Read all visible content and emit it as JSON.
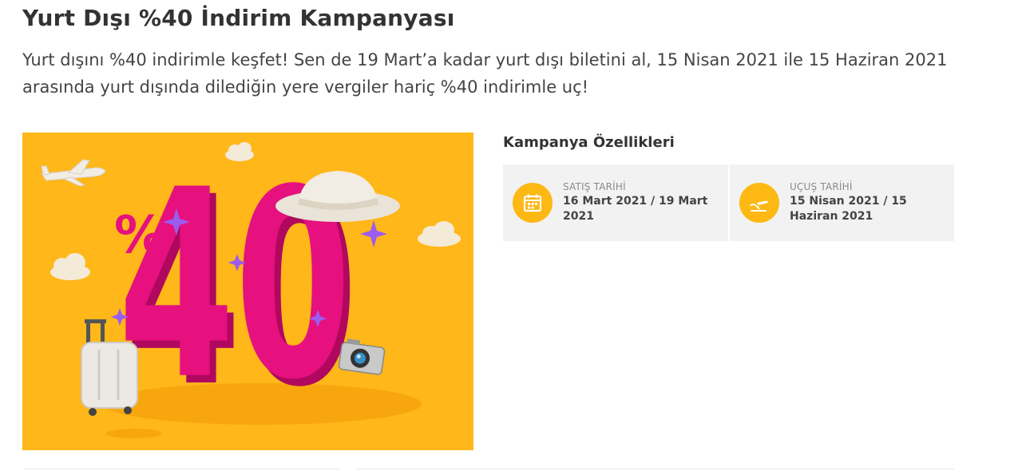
{
  "campaign": {
    "title": "Yurt Dışı %40 İndirim Kampanyası",
    "description": "Yurt dışını %40 indirimle keşfet! Sen de 19 Mart’a kadar yurt dışı biletini al, 15 Nisan 2021 ile 15 Haziran 2021 arasında yurt dışında dilediğin yere vergiler hariç %40 indirimle uç!"
  },
  "banner": {
    "percent_sign": "%",
    "number": "40"
  },
  "features": {
    "title": "Kampanya Özellikleri",
    "sales": {
      "icon": "calendar-icon",
      "label": "SATIŞ TARİHİ",
      "value": "16 Mart 2021 / 19 Mart 2021"
    },
    "flight": {
      "icon": "airplane-icon",
      "label": "UÇUŞ TARİHİ",
      "value": "15 Nisan 2021 / 15 Haziran 2021"
    }
  },
  "colors": {
    "banner_bg": "#ffb719",
    "accent_pink": "#e6107f",
    "icon_yellow": "#fdb813"
  }
}
